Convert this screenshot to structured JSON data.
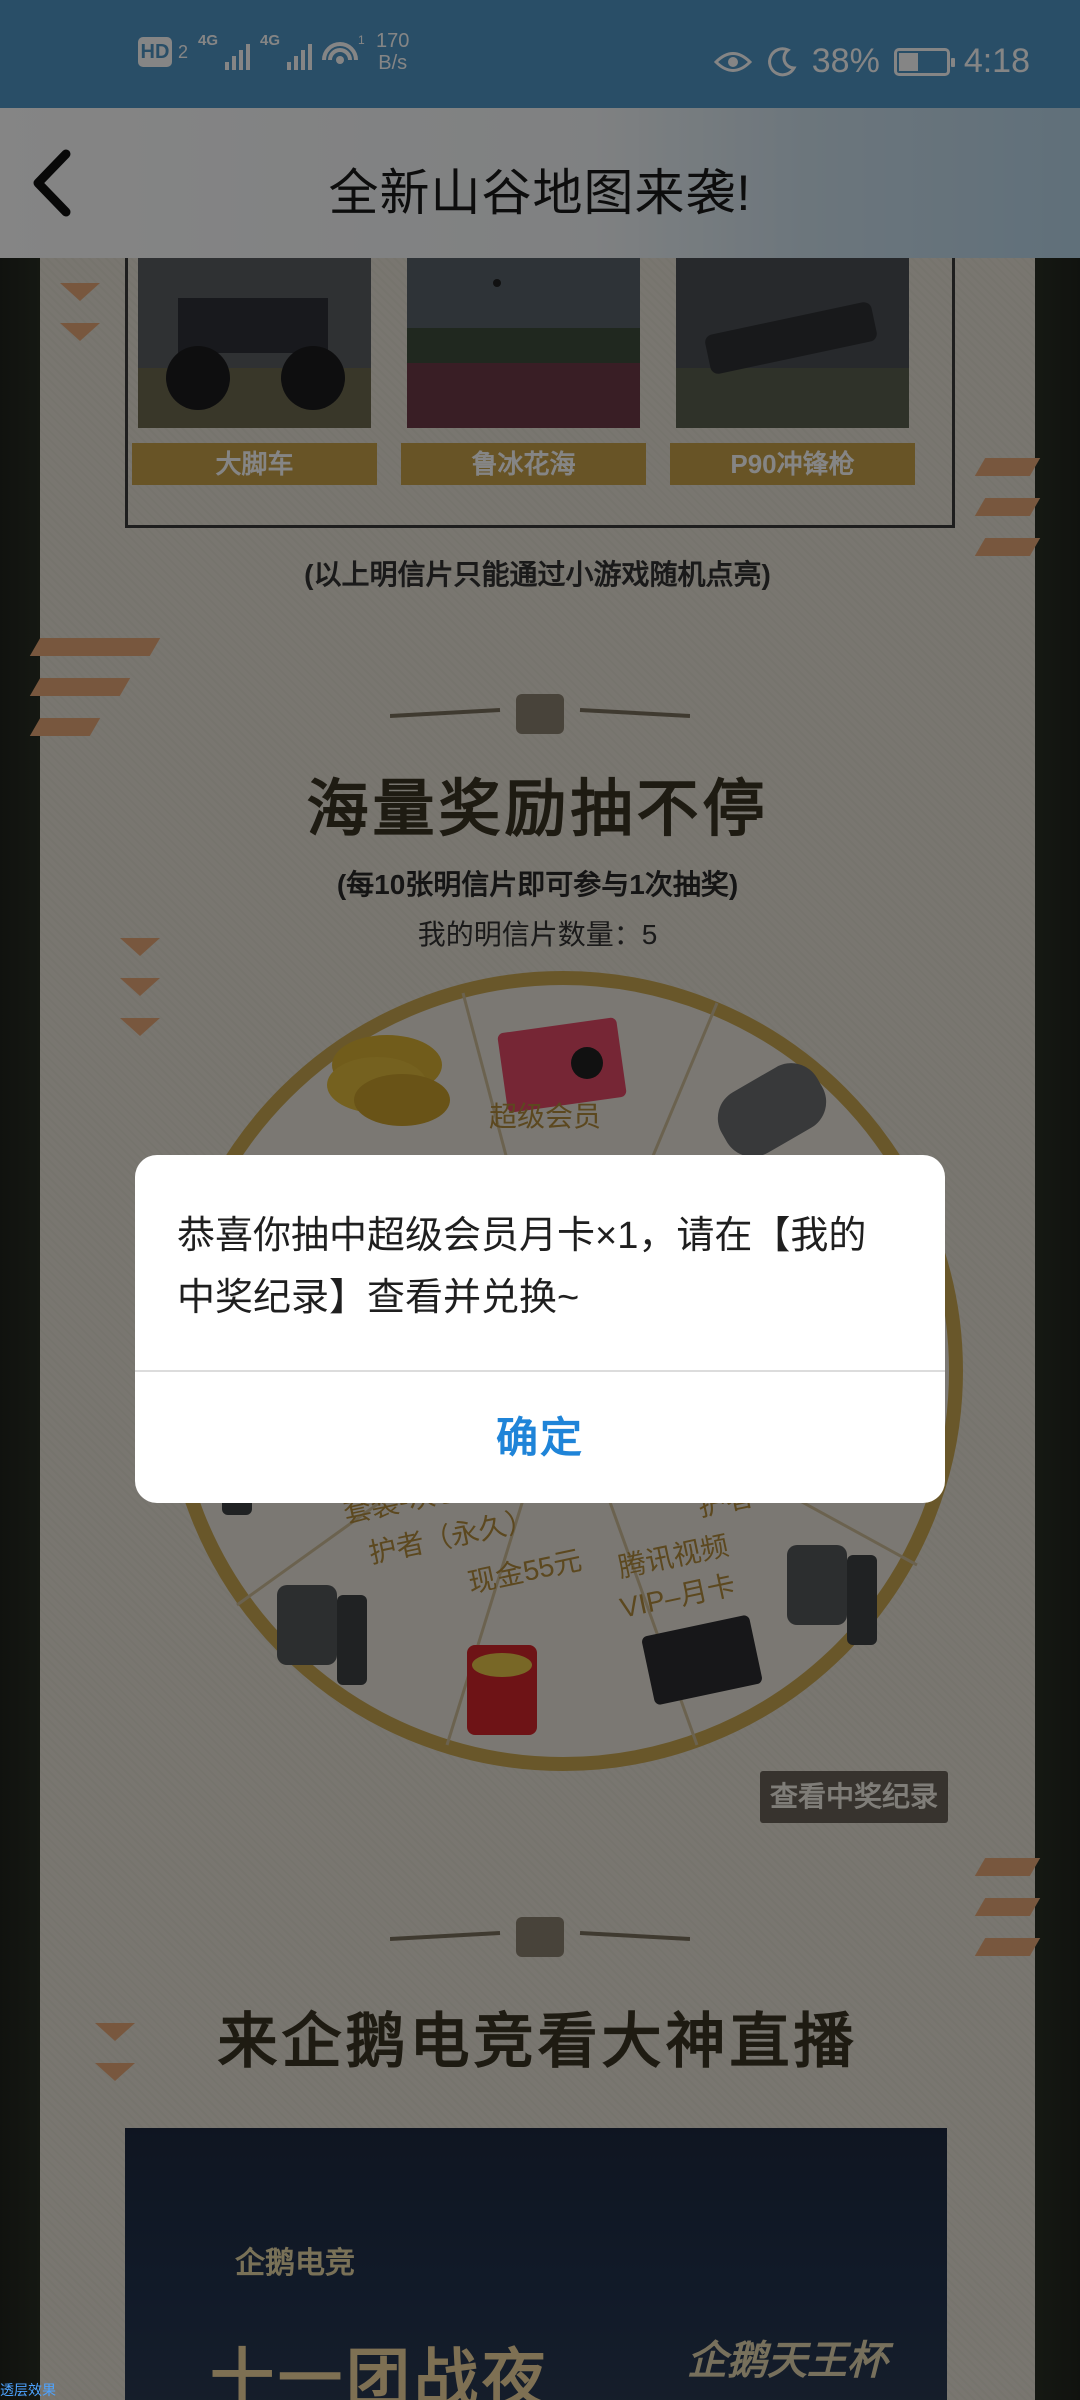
{
  "status_bar": {
    "hd": "HD",
    "sim": "2",
    "signal1_gen": "4G",
    "signal2_gen": "4G",
    "wifi_sub": "1",
    "speed_value": "170",
    "speed_unit": "B/s",
    "battery": "38%",
    "time": "4:18",
    "icons": [
      "eye-icon",
      "moon-icon",
      "battery-saver-icon"
    ]
  },
  "header": {
    "title": "全新山谷地图来袭!",
    "back_icon": "back-arrow-icon"
  },
  "postcards": {
    "items": [
      {
        "label": "大脚车"
      },
      {
        "label": "鲁冰花海"
      },
      {
        "label": "P90冲锋枪"
      }
    ],
    "note": "(以上明信片只能通过小游戏随机点亮)"
  },
  "lottery": {
    "heading": "海量奖励抽不停",
    "subheading": "(每10张明信片即可参与1次抽奖)",
    "count_text": "我的明信片数量：5",
    "prizes": [
      {
        "label": "超级会员",
        "icon": "qq-vip-card-icon"
      },
      {
        "label": "套装-灰色守护者 (永久)",
        "icon": "outfit-icon"
      },
      {
        "label": "现金55元",
        "icon": "red-packet-icon"
      },
      {
        "label": "腾讯视频VIP-月卡",
        "icon": "video-vip-card-icon"
      },
      {
        "label": "护者",
        "icon": "outfit-icon"
      }
    ],
    "prize_lines": {
      "vip": "超级会员",
      "outfit1": "套装-灰色守",
      "outfit2": "护者（永久）",
      "cash": "现金55元",
      "video1": "腾讯视频",
      "video2": "VIP–月卡",
      "guardian": "护者（"
    },
    "record_button": "查看中奖纪录"
  },
  "live": {
    "heading": "来企鹅电竞看大神直播",
    "banner_logo": "企鹅电竞",
    "banner_title": "十一团战夜",
    "banner_cup": "企鹅天王杯"
  },
  "dialog": {
    "message": "恭喜你抽中超级会员月卡×1，请在【我的中奖纪录】查看并兑换~",
    "confirm": "确定"
  },
  "corner_text": "透层效果"
}
